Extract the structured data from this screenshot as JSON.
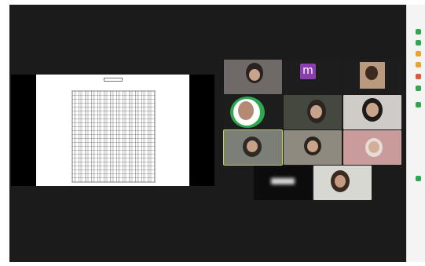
{
  "share": {
    "doc_title": ""
  },
  "avatar": {
    "initial": "m"
  },
  "participants": [
    {
      "label": ""
    },
    {
      "label": ""
    },
    {
      "label": ""
    },
    {
      "label": ""
    },
    {
      "label": ""
    },
    {
      "label": ""
    },
    {
      "label": ""
    },
    {
      "label": ""
    },
    {
      "label": ""
    },
    {
      "label": ""
    },
    {
      "label": ""
    },
    {
      "label": ""
    }
  ],
  "colors": {
    "avatar_purple": "#8a3fb0",
    "active_border": "#c7d44a",
    "panel_green": "#2ea84e",
    "panel_orange": "#f0a12b",
    "panel_red": "#e2563b"
  }
}
